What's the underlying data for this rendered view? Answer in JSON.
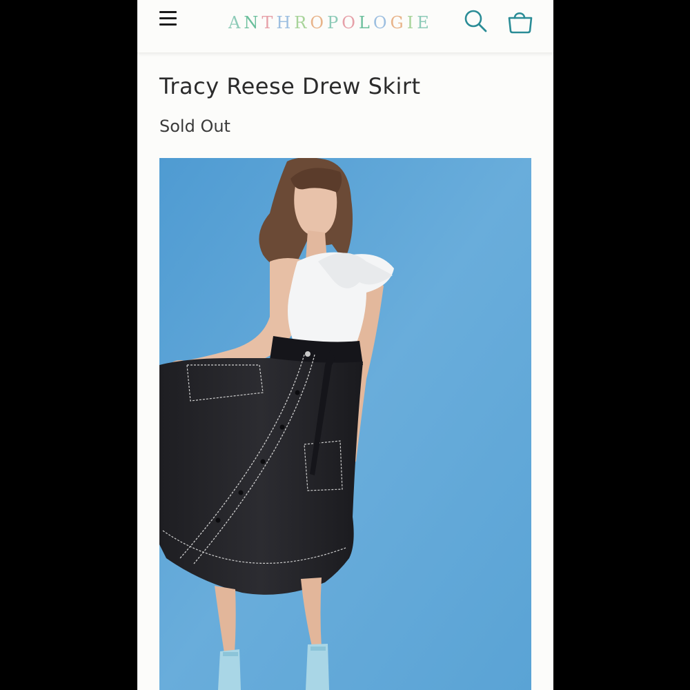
{
  "header": {
    "logo_text": "ANTHROPOLOGIE",
    "logo_colors": [
      "#8ecbb8",
      "#6bbf9c",
      "#e6a0a8",
      "#9dbfe0",
      "#a8d49a",
      "#e8b48a",
      "#8ecbb8",
      "#e6a0a8",
      "#6bbf9c",
      "#9dbfe0",
      "#e8b48a",
      "#a8d49a",
      "#8ecbb8"
    ],
    "icons": {
      "menu": "menu-icon",
      "search": "search-icon",
      "bag": "shopping-bag-icon"
    },
    "accent_color": "#2a8c96"
  },
  "product": {
    "title": "Tracy Reese Drew Skirt",
    "status": "Sold Out",
    "image_background": "#5ea6d6"
  }
}
